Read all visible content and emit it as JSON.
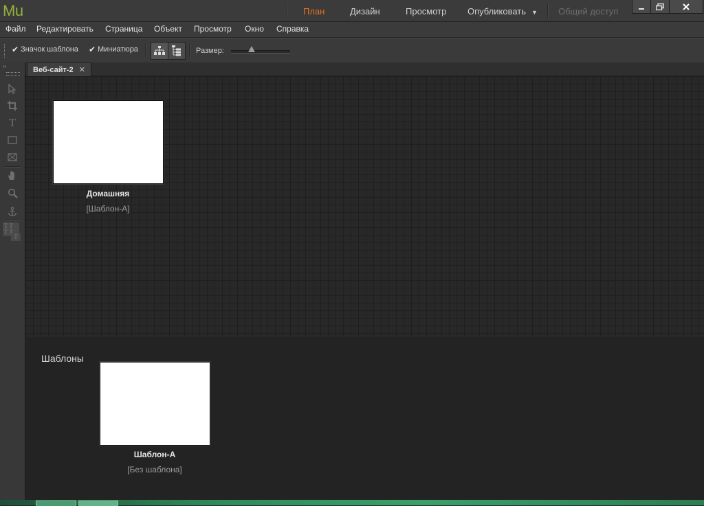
{
  "app": {
    "logo": "Mu",
    "modes": [
      {
        "label": "План",
        "state": "active"
      },
      {
        "label": "Дизайн",
        "state": "normal"
      },
      {
        "label": "Просмотр",
        "state": "normal"
      },
      {
        "label": "Опубликовать",
        "state": "normal"
      },
      {
        "label": "Общий доступ",
        "state": "disabled"
      }
    ],
    "accent_color": "#e8731e",
    "logo_color": "#95b13b"
  },
  "menu": [
    "Файл",
    "Редактировать",
    "Страница",
    "Объект",
    "Просмотр",
    "Окно",
    "Справка"
  ],
  "options": {
    "show_master_icon": {
      "label": "Значок шаблона",
      "checked": true
    },
    "thumbnail": {
      "label": "Миниатюра",
      "checked": true
    },
    "size_label": "Размер:",
    "size_value": 0.35
  },
  "tools": [
    "selection-icon",
    "crop-icon",
    "text-icon",
    "rectangle-icon",
    "image-frame-icon",
    "hand-icon",
    "zoom-icon",
    "anchor-icon",
    "text-wrap-icon"
  ],
  "document": {
    "tab_label": "Веб-сайт-2",
    "pages": [
      {
        "name": "Домашняя",
        "template": "[Шаблон-A]"
      }
    ],
    "masters_title": "Шаблоны",
    "masters": [
      {
        "name": "Шаблон-A",
        "template": "[Без шаблона]"
      }
    ]
  }
}
